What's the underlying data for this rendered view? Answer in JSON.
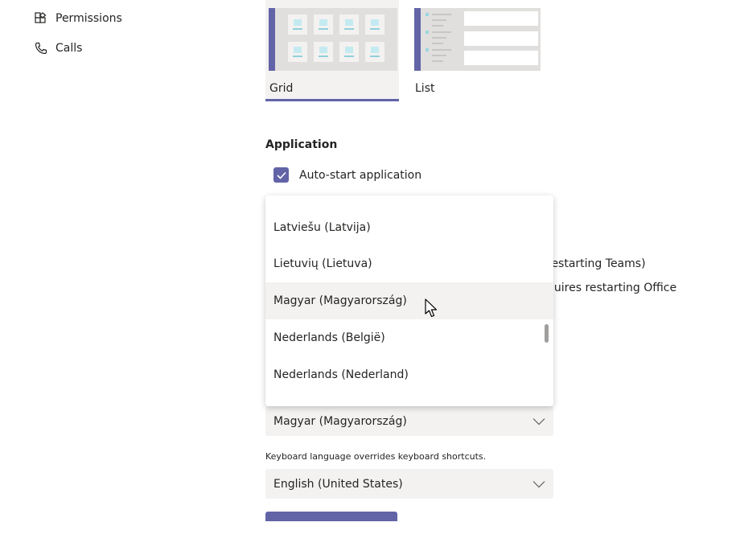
{
  "sidebar": {
    "items": [
      {
        "label": "Permissions",
        "icon": "permissions-icon"
      },
      {
        "label": "Calls",
        "icon": "phone-icon"
      }
    ]
  },
  "layout": {
    "options": [
      {
        "label": "Grid",
        "selected": true
      },
      {
        "label": "List",
        "selected": false
      }
    ]
  },
  "application": {
    "heading": "Application",
    "auto_start_label": "Auto-start application",
    "auto_start_checked": true
  },
  "hidden_text": {
    "line1": "restarting Teams)",
    "line2": "quires restarting Office"
  },
  "language_dropdown": {
    "options": [
      "Latviešu (Latvija)",
      "Lietuvių (Lietuva)",
      "Magyar (Magyarország)",
      "Nederlands (België)",
      "Nederlands (Nederland)"
    ],
    "hovered_index": 2
  },
  "display_language": {
    "value": "Magyar (Magyarország)"
  },
  "keyboard_language": {
    "note": "Keyboard language overrides keyboard shortcuts.",
    "value": "English (United States)"
  },
  "colors": {
    "accent": "#6264a7",
    "hover": "#f3f2f1"
  }
}
